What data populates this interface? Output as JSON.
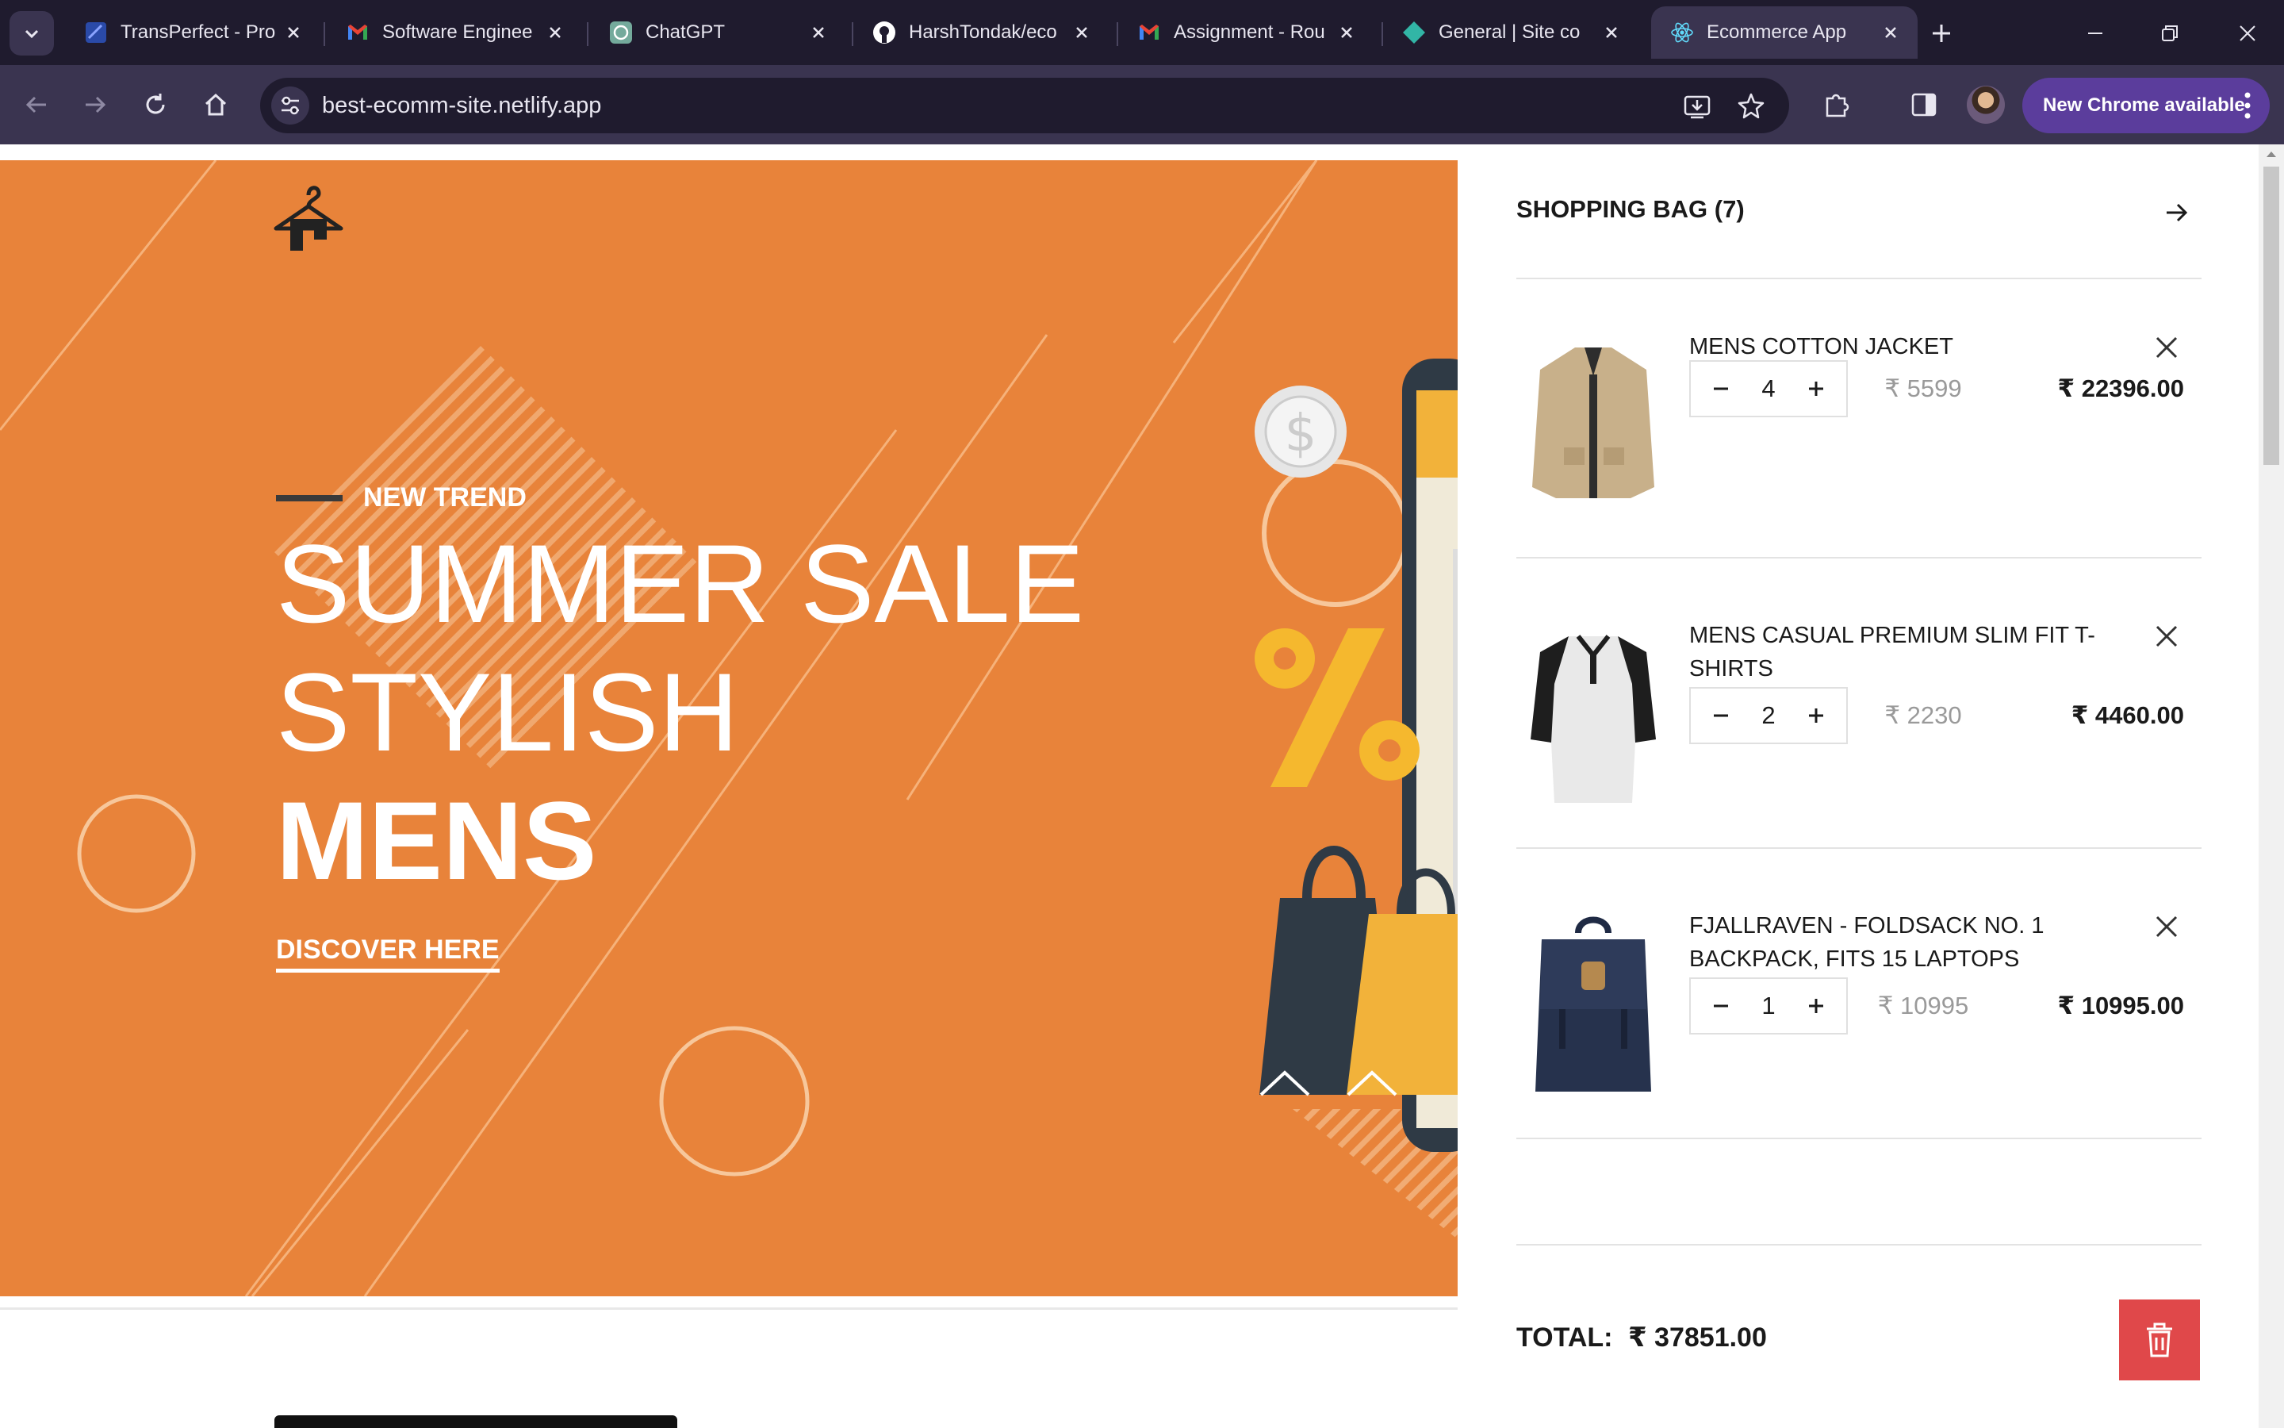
{
  "browser": {
    "tabs": [
      {
        "title": "TransPerfect - Pro",
        "icon": "transperfect-icon"
      },
      {
        "title": "Software Enginee",
        "icon": "gmail-icon"
      },
      {
        "title": "ChatGPT",
        "icon": "chatgpt-icon"
      },
      {
        "title": "HarshTondak/eco",
        "icon": "github-icon"
      },
      {
        "title": "Assignment - Rou",
        "icon": "gmail-icon"
      },
      {
        "title": "General | Site co",
        "icon": "netlify-icon"
      },
      {
        "title": "Ecommerce App",
        "icon": "react-icon",
        "active": true
      }
    ],
    "url": "best-ecomm-site.netlify.app",
    "update_label": "New Chrome available"
  },
  "hero": {
    "tag": "NEW TREND",
    "line1": "SUMMER SALE",
    "line2": "STYLISH",
    "line3": "MENS",
    "cta": "DISCOVER HERE"
  },
  "cart": {
    "title": "SHOPPING BAG (7)",
    "currency": "₹",
    "items": [
      {
        "name": "MENS COTTON JACKET",
        "qty": "4",
        "unit_price": "₹ 5599",
        "line_total": "₹ 22396.00"
      },
      {
        "name": "MENS CASUAL PREMIUM SLIM FIT T-SHIRTS",
        "qty": "2",
        "unit_price": "₹ 2230",
        "line_total": "₹ 4460.00"
      },
      {
        "name": "FJALLRAVEN - FOLDSACK NO. 1 BACKPACK, FITS 15 LAPTOPS",
        "qty": "1",
        "unit_price": "₹ 10995",
        "line_total": "₹ 10995.00"
      }
    ],
    "total_label": "TOTAL:",
    "total_value": "₹ 37851.00"
  },
  "colors": {
    "hero_bg": "#e8833a",
    "clear_button": "#e0484a",
    "chrome_frame": "#1f1b2e",
    "chrome_toolbar": "#3a3450",
    "update_button": "#5b3d9c"
  }
}
